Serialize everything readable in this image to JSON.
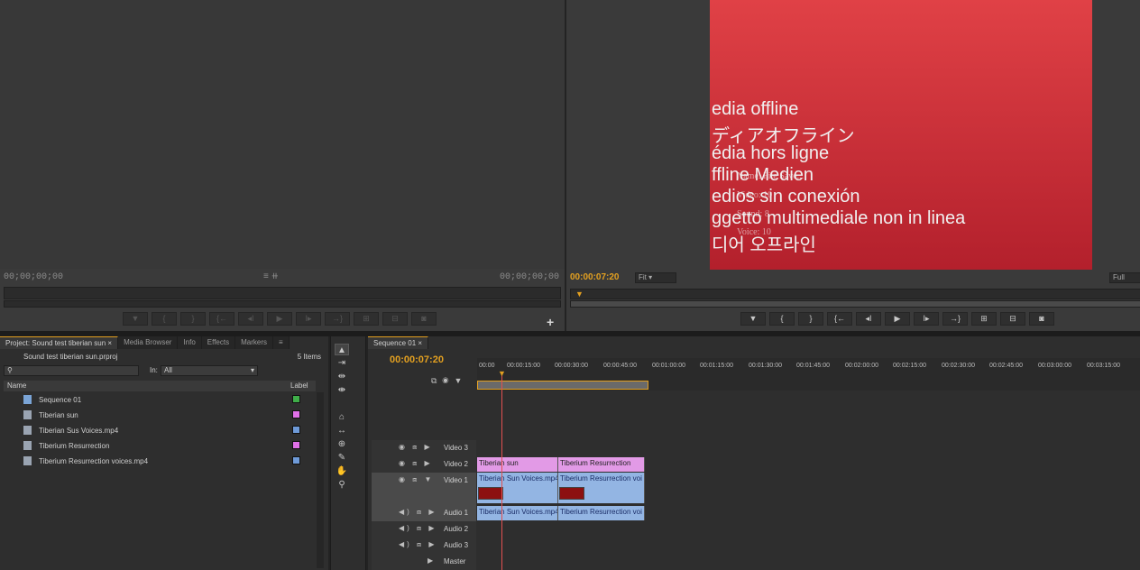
{
  "source_monitor": {
    "timecode_left": "00;00;00;00",
    "timecode_right": "00;00;00;00",
    "mid_icons": "≡ ⧺",
    "buttons": [
      "▼",
      "{",
      "}",
      "{←",
      "◂I",
      "▶",
      "I▸",
      "→}",
      "⊞",
      "⊟",
      "◙"
    ],
    "add_button": "+"
  },
  "program_monitor": {
    "timecode": "00:00:07:20",
    "zoom": "Fit",
    "resolution": "Full",
    "offline_lines": [
      "edia offline",
      "ディアオフライン",
      "édia hors ligne",
      "ffline Medien",
      "edios sin conexión",
      "ggetto multimediale non in linea",
      "디어 오프라인"
    ],
    "overlay_lines": [
      "Name: File Save...",
      "Video: 10",
      "Sound: 8",
      "Voice: 10"
    ],
    "buttons": [
      "▼",
      "{",
      "}",
      "{←",
      "◂I",
      "▶",
      "I▸",
      "→}",
      "⊞",
      "⊟",
      "◙"
    ]
  },
  "project_panel": {
    "tabs": [
      "Project: Sound test tiberian sun ×",
      "Media Browser",
      "Info",
      "Effects",
      "Markers",
      "≡"
    ],
    "file_name": "Sound test tiberian sun.prproj",
    "item_count": "5 Items",
    "search_placeholder": "",
    "in_label": "In:",
    "in_value": "All",
    "col_name": "Name",
    "col_label": "Label",
    "items": [
      {
        "name": "Sequence 01",
        "color": "#3fae49"
      },
      {
        "name": "Tiberian sun",
        "color": "#e070e8"
      },
      {
        "name": "Tiberian Sus Voices.mp4",
        "color": "#6e9ad8"
      },
      {
        "name": "Tiberium Resurrection",
        "color": "#e070e8"
      },
      {
        "name": "Tiberium Resurrection voices.mp4",
        "color": "#6e9ad8"
      }
    ]
  },
  "tools": [
    "▲",
    "⇥",
    "⇹",
    "⇼",
    "⌂",
    "↔",
    "⊕",
    "✎",
    "✋",
    "⚲"
  ],
  "timeline": {
    "tab": "Sequence 01 ×",
    "timecode": "00:00:07:20",
    "ticks": [
      "00:00",
      "00:00:15:00",
      "00:00:30:00",
      "00:00:45:00",
      "00:01:00:00",
      "00:01:15:00",
      "00:01:30:00",
      "00:01:45:00",
      "00:02:00:00",
      "00:02:15:00",
      "00:02:30:00",
      "00:02:45:00",
      "00:03:00:00",
      "00:03:15:00"
    ],
    "tracks": [
      "Video 3",
      "Video 2",
      "Video 1",
      "Audio 1",
      "Audio 2",
      "Audio 3",
      "Master"
    ],
    "clips": {
      "v2_a": "Tiberian sun",
      "v2_b": "Tiberium Resurrection",
      "v1_a": "Tiberian Sun Voices.mp4",
      "v1_b": "Tiberium Resurrection voi",
      "a1_a": "Tiberian Sun Voices.mp4",
      "a1_b": "Tiberium Resurrection voi"
    }
  }
}
